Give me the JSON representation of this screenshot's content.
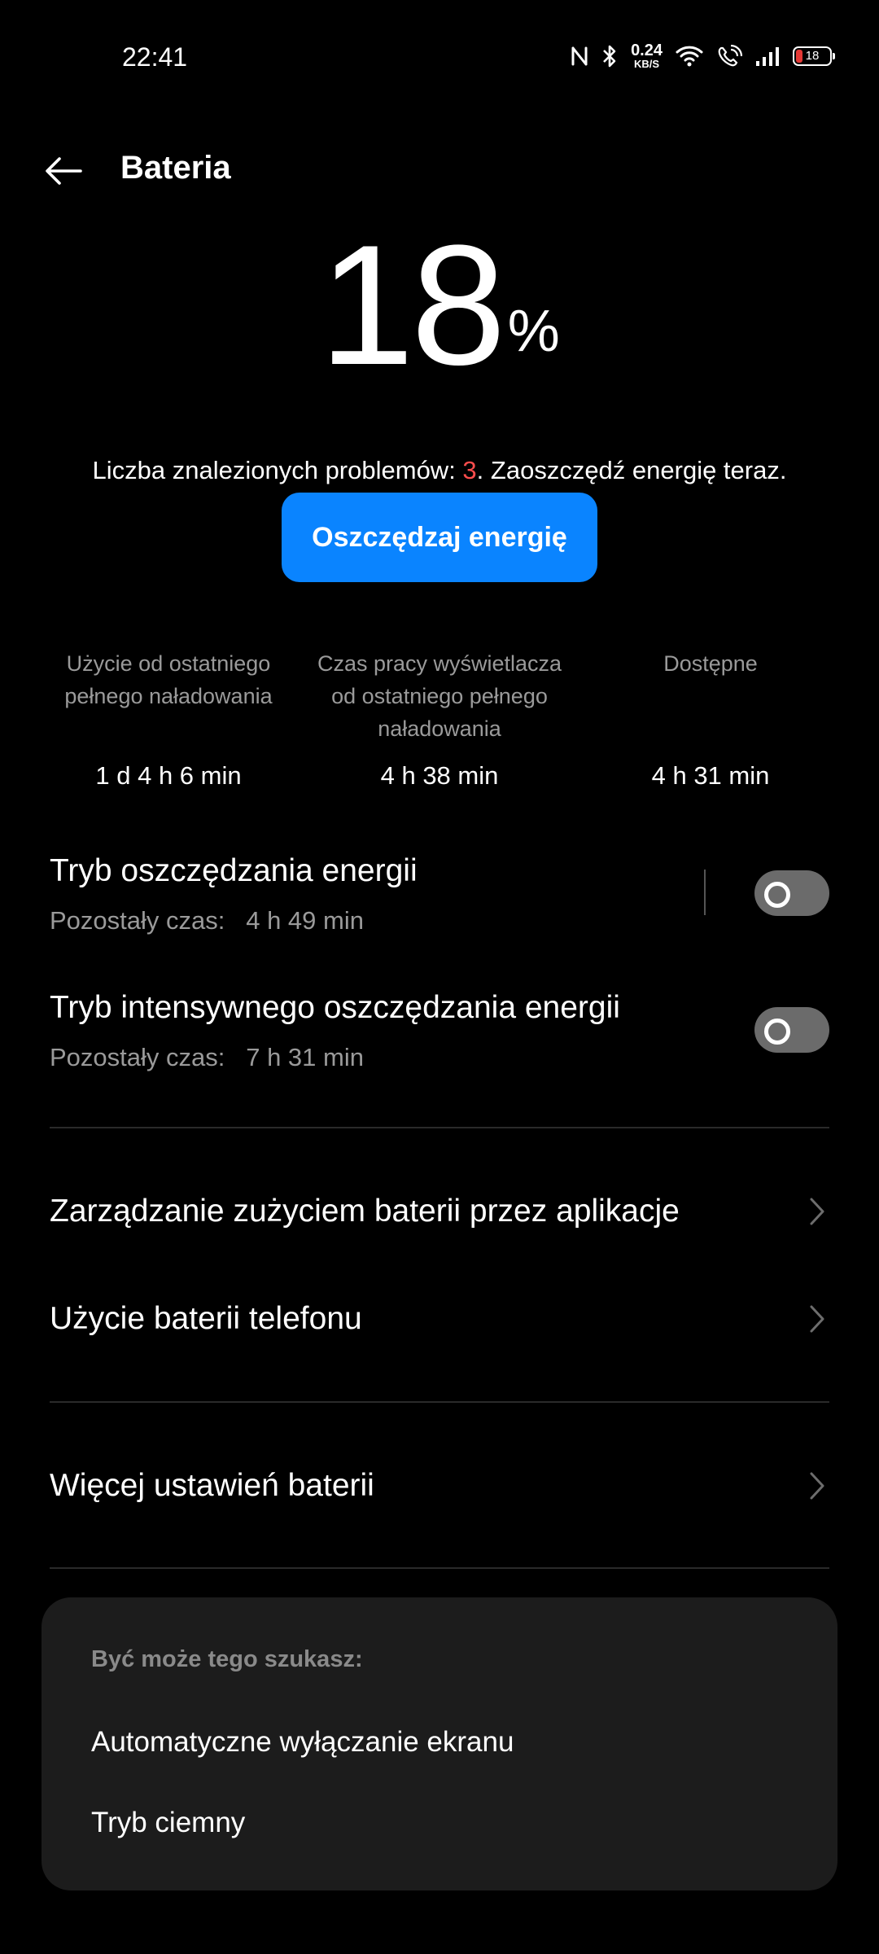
{
  "status_bar": {
    "time": "22:41",
    "net_speed_value": "0.24",
    "net_speed_unit": "KB/S",
    "battery_level": "18",
    "icons": [
      "nfc-icon",
      "bluetooth-icon",
      "wifi-icon",
      "wifi-calling-icon",
      "signal-icon",
      "battery-icon"
    ]
  },
  "header": {
    "title": "Bateria"
  },
  "battery": {
    "level": "18",
    "unit": "%"
  },
  "problems": {
    "prefix": "Liczba znalezionych problemów: ",
    "count": "3",
    "suffix": ". Zaoszczędź energię teraz."
  },
  "save_button": {
    "label": "Oszczędzaj energię"
  },
  "stats": [
    {
      "label": "Użycie od ostatniego pełnego naładowania",
      "value": "1 d 4 h 6 min"
    },
    {
      "label": "Czas pracy wyświetlacza od ostatniego pełnego naładowania",
      "value": "4 h 38 min"
    },
    {
      "label": "Dostępne",
      "value": "4 h 31 min"
    }
  ],
  "modes": [
    {
      "title": "Tryb oszczędzania energii",
      "remaining_label": "Pozostały czas:",
      "remaining_value": "4 h 49 min",
      "enabled": false
    },
    {
      "title": "Tryb intensywnego oszczędzania energii",
      "remaining_label": "Pozostały czas:",
      "remaining_value": "7 h 31 min",
      "enabled": false
    }
  ],
  "menu": [
    {
      "label": "Zarządzanie zużyciem baterii przez aplikacje"
    },
    {
      "label": "Użycie baterii telefonu"
    },
    {
      "label": "Więcej ustawień baterii"
    }
  ],
  "suggestions": {
    "title": "Być może tego szukasz:",
    "items": [
      "Automatyczne wyłączanie ekranu",
      "Tryb ciemny"
    ]
  },
  "colors": {
    "accent": "#0a84ff",
    "warning": "#ff4d4d",
    "background": "#000000",
    "card": "#1c1c1c"
  }
}
